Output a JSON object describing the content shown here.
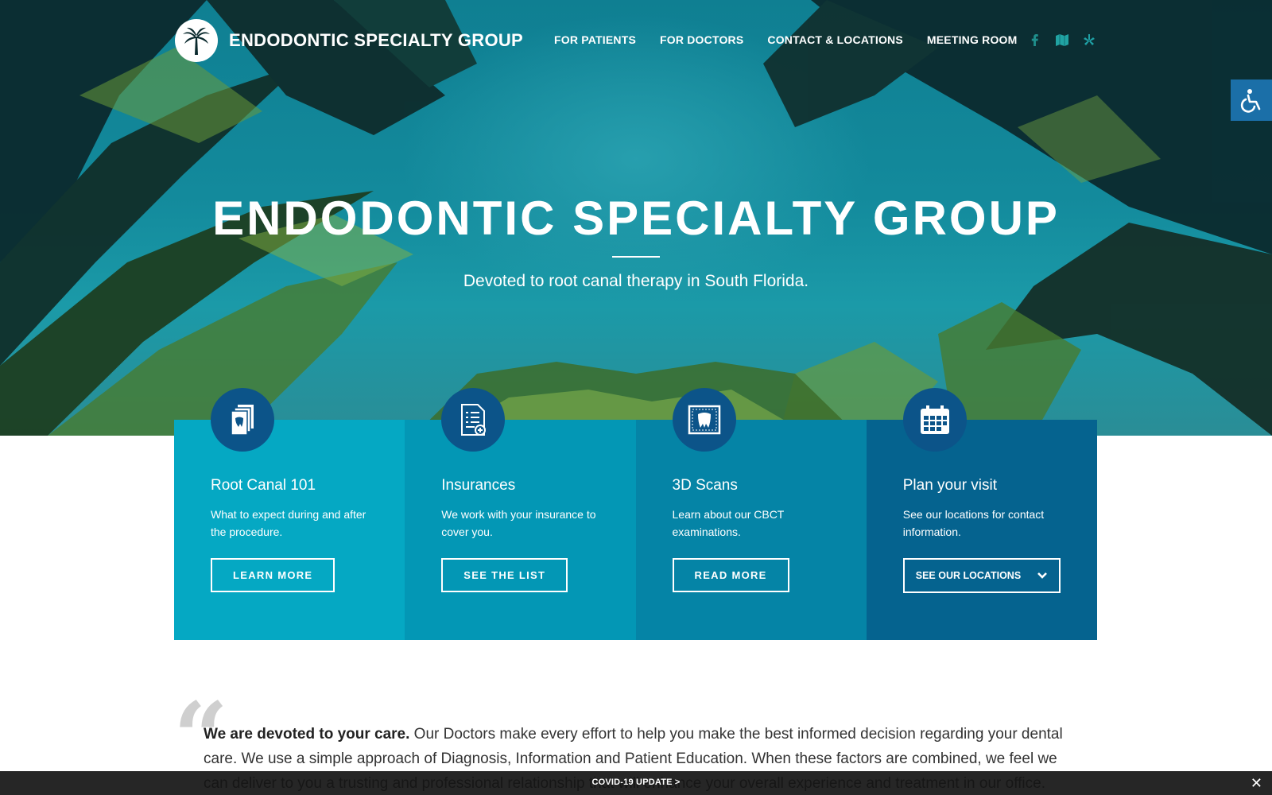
{
  "header": {
    "brand": "ENDODONTIC SPECIALTY GROUP",
    "nav": [
      {
        "label": "FOR PATIENTS"
      },
      {
        "label": "FOR DOCTORS"
      },
      {
        "label": "CONTACT & LOCATIONS"
      },
      {
        "label": "MEETING ROOM"
      }
    ],
    "social_icons": [
      "facebook-icon",
      "map-icon",
      "yelp-icon"
    ]
  },
  "hero": {
    "title": "ENDODONTIC SPECIALTY GROUP",
    "subtitle": "Devoted to root canal therapy in South Florida."
  },
  "cards": [
    {
      "icon": "tooth-book-icon",
      "title": "Root Canal 101",
      "desc": "What to expect during and after the procedure.",
      "button": "LEARN MORE",
      "color": "#05a8c3"
    },
    {
      "icon": "document-icon",
      "title": "Insurances",
      "desc": "We work with your insurance to cover you.",
      "button": "SEE THE LIST",
      "color": "#0397b5"
    },
    {
      "icon": "scan-tooth-icon",
      "title": "3D Scans",
      "desc": "Learn about our CBCT examinations.",
      "button": "READ MORE",
      "color": "#0584a6"
    },
    {
      "icon": "calendar-icon",
      "title": "Plan your visit",
      "desc": "See our locations for contact information.",
      "button": "SEE OUR LOCATIONS",
      "color": "#05638f"
    }
  ],
  "quote": {
    "lead": "We are devoted to your care.",
    "body": " Our Doctors make every effort to help you make the best informed decision regarding your dental care. We use a simple approach of Diagnosis, Information and Patient Education. When these factors are combined, we feel we can deliver to you a trusting and professional relationship that will enhance your overall experience and treatment in our office."
  },
  "banner": {
    "label": "COVID-19 UPDATE >",
    "close": "✕"
  },
  "colors": {
    "hero": "#138a9c",
    "icon_circle": "#0c5489",
    "access": "#1b6fa8"
  }
}
